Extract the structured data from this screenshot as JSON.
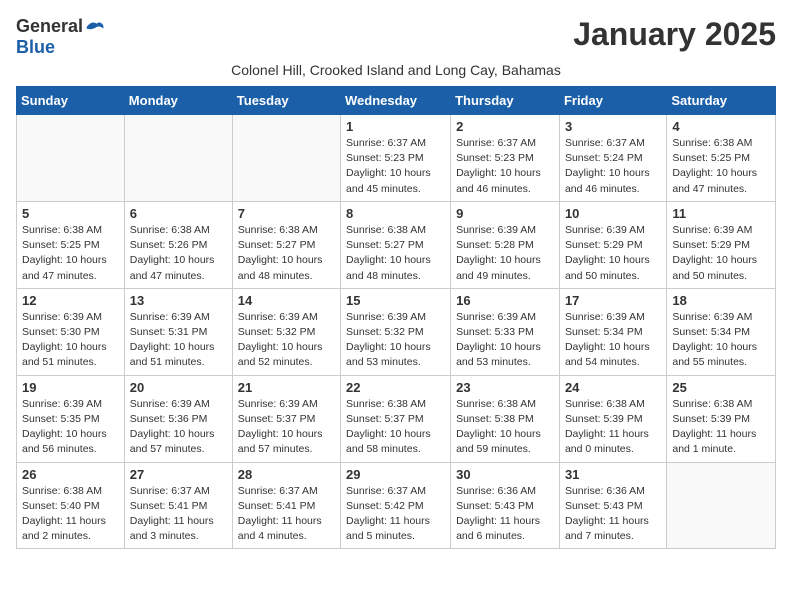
{
  "logo": {
    "general": "General",
    "blue": "Blue"
  },
  "header": {
    "month_title": "January 2025",
    "subtitle": "Colonel Hill, Crooked Island and Long Cay, Bahamas"
  },
  "days_of_week": [
    "Sunday",
    "Monday",
    "Tuesday",
    "Wednesday",
    "Thursday",
    "Friday",
    "Saturday"
  ],
  "weeks": [
    [
      {
        "day": "",
        "info": ""
      },
      {
        "day": "",
        "info": ""
      },
      {
        "day": "",
        "info": ""
      },
      {
        "day": "1",
        "info": "Sunrise: 6:37 AM\nSunset: 5:23 PM\nDaylight: 10 hours\nand 45 minutes."
      },
      {
        "day": "2",
        "info": "Sunrise: 6:37 AM\nSunset: 5:23 PM\nDaylight: 10 hours\nand 46 minutes."
      },
      {
        "day": "3",
        "info": "Sunrise: 6:37 AM\nSunset: 5:24 PM\nDaylight: 10 hours\nand 46 minutes."
      },
      {
        "day": "4",
        "info": "Sunrise: 6:38 AM\nSunset: 5:25 PM\nDaylight: 10 hours\nand 47 minutes."
      }
    ],
    [
      {
        "day": "5",
        "info": "Sunrise: 6:38 AM\nSunset: 5:25 PM\nDaylight: 10 hours\nand 47 minutes."
      },
      {
        "day": "6",
        "info": "Sunrise: 6:38 AM\nSunset: 5:26 PM\nDaylight: 10 hours\nand 47 minutes."
      },
      {
        "day": "7",
        "info": "Sunrise: 6:38 AM\nSunset: 5:27 PM\nDaylight: 10 hours\nand 48 minutes."
      },
      {
        "day": "8",
        "info": "Sunrise: 6:38 AM\nSunset: 5:27 PM\nDaylight: 10 hours\nand 48 minutes."
      },
      {
        "day": "9",
        "info": "Sunrise: 6:39 AM\nSunset: 5:28 PM\nDaylight: 10 hours\nand 49 minutes."
      },
      {
        "day": "10",
        "info": "Sunrise: 6:39 AM\nSunset: 5:29 PM\nDaylight: 10 hours\nand 50 minutes."
      },
      {
        "day": "11",
        "info": "Sunrise: 6:39 AM\nSunset: 5:29 PM\nDaylight: 10 hours\nand 50 minutes."
      }
    ],
    [
      {
        "day": "12",
        "info": "Sunrise: 6:39 AM\nSunset: 5:30 PM\nDaylight: 10 hours\nand 51 minutes."
      },
      {
        "day": "13",
        "info": "Sunrise: 6:39 AM\nSunset: 5:31 PM\nDaylight: 10 hours\nand 51 minutes."
      },
      {
        "day": "14",
        "info": "Sunrise: 6:39 AM\nSunset: 5:32 PM\nDaylight: 10 hours\nand 52 minutes."
      },
      {
        "day": "15",
        "info": "Sunrise: 6:39 AM\nSunset: 5:32 PM\nDaylight: 10 hours\nand 53 minutes."
      },
      {
        "day": "16",
        "info": "Sunrise: 6:39 AM\nSunset: 5:33 PM\nDaylight: 10 hours\nand 53 minutes."
      },
      {
        "day": "17",
        "info": "Sunrise: 6:39 AM\nSunset: 5:34 PM\nDaylight: 10 hours\nand 54 minutes."
      },
      {
        "day": "18",
        "info": "Sunrise: 6:39 AM\nSunset: 5:34 PM\nDaylight: 10 hours\nand 55 minutes."
      }
    ],
    [
      {
        "day": "19",
        "info": "Sunrise: 6:39 AM\nSunset: 5:35 PM\nDaylight: 10 hours\nand 56 minutes."
      },
      {
        "day": "20",
        "info": "Sunrise: 6:39 AM\nSunset: 5:36 PM\nDaylight: 10 hours\nand 57 minutes."
      },
      {
        "day": "21",
        "info": "Sunrise: 6:39 AM\nSunset: 5:37 PM\nDaylight: 10 hours\nand 57 minutes."
      },
      {
        "day": "22",
        "info": "Sunrise: 6:38 AM\nSunset: 5:37 PM\nDaylight: 10 hours\nand 58 minutes."
      },
      {
        "day": "23",
        "info": "Sunrise: 6:38 AM\nSunset: 5:38 PM\nDaylight: 10 hours\nand 59 minutes."
      },
      {
        "day": "24",
        "info": "Sunrise: 6:38 AM\nSunset: 5:39 PM\nDaylight: 11 hours\nand 0 minutes."
      },
      {
        "day": "25",
        "info": "Sunrise: 6:38 AM\nSunset: 5:39 PM\nDaylight: 11 hours\nand 1 minute."
      }
    ],
    [
      {
        "day": "26",
        "info": "Sunrise: 6:38 AM\nSunset: 5:40 PM\nDaylight: 11 hours\nand 2 minutes."
      },
      {
        "day": "27",
        "info": "Sunrise: 6:37 AM\nSunset: 5:41 PM\nDaylight: 11 hours\nand 3 minutes."
      },
      {
        "day": "28",
        "info": "Sunrise: 6:37 AM\nSunset: 5:41 PM\nDaylight: 11 hours\nand 4 minutes."
      },
      {
        "day": "29",
        "info": "Sunrise: 6:37 AM\nSunset: 5:42 PM\nDaylight: 11 hours\nand 5 minutes."
      },
      {
        "day": "30",
        "info": "Sunrise: 6:36 AM\nSunset: 5:43 PM\nDaylight: 11 hours\nand 6 minutes."
      },
      {
        "day": "31",
        "info": "Sunrise: 6:36 AM\nSunset: 5:43 PM\nDaylight: 11 hours\nand 7 minutes."
      },
      {
        "day": "",
        "info": ""
      }
    ]
  ]
}
